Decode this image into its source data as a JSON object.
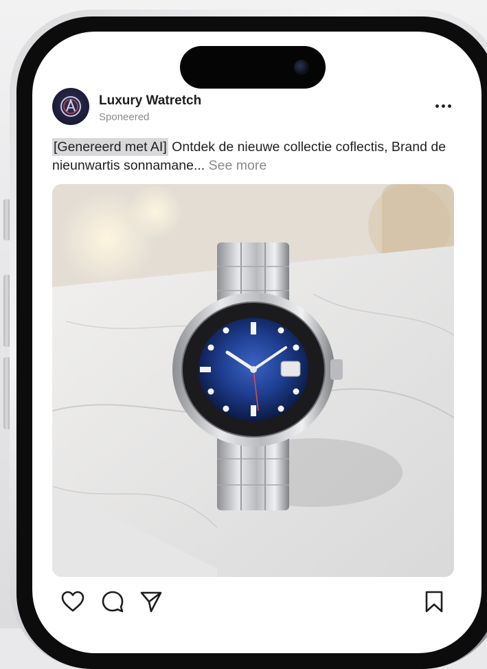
{
  "post": {
    "account_name": "Luxury Watretch",
    "sponsored_label": "Sponeered",
    "caption": {
      "ai_tag": "[Genereerd met AI]",
      "text": " Ontdek de nieuwe collectie coflectis, Brand de nieunwartis sonnamane...",
      "see_more": "See more"
    },
    "media": {
      "subject": "wristwatch with blue dial and black bezel on marble surface"
    },
    "actions": [
      "heart-icon",
      "comment-icon",
      "share-icon",
      "bookmark-icon"
    ]
  },
  "colors": {
    "dial": "#1e3d8f",
    "bezel": "#1b1b1d",
    "screen": "#ffffff",
    "text": "#1c1c1c",
    "muted": "#8a8a8a"
  }
}
